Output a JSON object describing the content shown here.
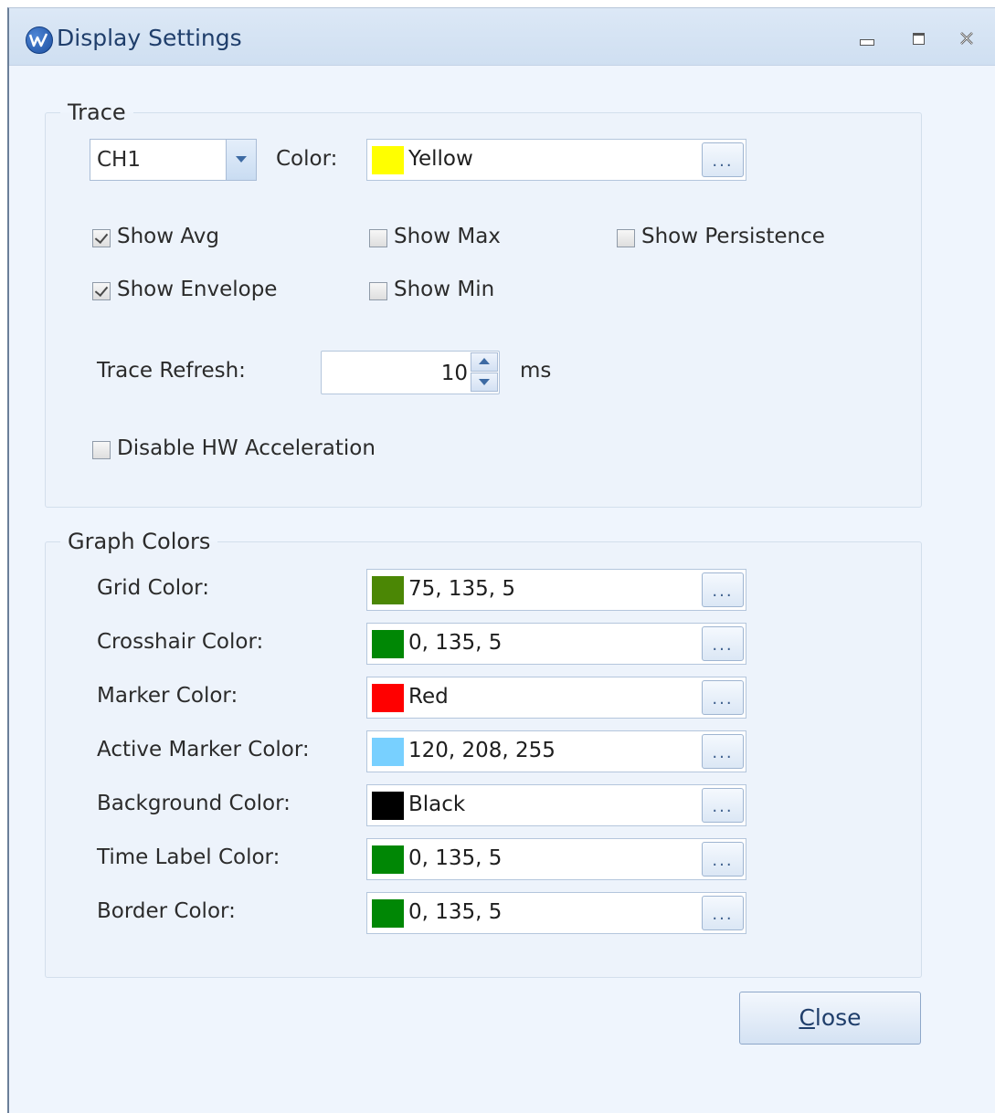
{
  "window": {
    "title": "Display Settings"
  },
  "trace": {
    "legend": "Trace",
    "channel": "CH1",
    "color_label": "Color:",
    "color_value": "Yellow",
    "color_hex": "#ffff00",
    "ellipsis": "...",
    "checkboxes": {
      "show_avg": {
        "label": "Show Avg",
        "checked": true
      },
      "show_max": {
        "label": "Show Max",
        "checked": false
      },
      "show_persistence": {
        "label": "Show Persistence",
        "checked": false
      },
      "show_envelope": {
        "label": "Show Envelope",
        "checked": true
      },
      "show_min": {
        "label": "Show Min",
        "checked": false
      },
      "disable_hw": {
        "label": "Disable HW Acceleration",
        "checked": false
      }
    },
    "refresh_label": "Trace Refresh:",
    "refresh_value": "10",
    "refresh_unit": "ms"
  },
  "graph_colors": {
    "legend": "Graph Colors",
    "rows": [
      {
        "label": "Grid Color:",
        "value": "75, 135, 5",
        "hex": "#4b8705"
      },
      {
        "label": "Crosshair Color:",
        "value": "0, 135, 5",
        "hex": "#008705"
      },
      {
        "label": "Marker Color:",
        "value": "Red",
        "hex": "#ff0000"
      },
      {
        "label": "Active Marker Color:",
        "value": "120, 208, 255",
        "hex": "#78d0ff"
      },
      {
        "label": "Background Color:",
        "value": "Black",
        "hex": "#000000"
      },
      {
        "label": "Time Label Color:",
        "value": "0, 135, 5",
        "hex": "#008705"
      },
      {
        "label": "Border Color:",
        "value": "0, 135, 5",
        "hex": "#008705"
      }
    ]
  },
  "buttons": {
    "close_mnemonic": "C",
    "close_rest": "lose"
  }
}
